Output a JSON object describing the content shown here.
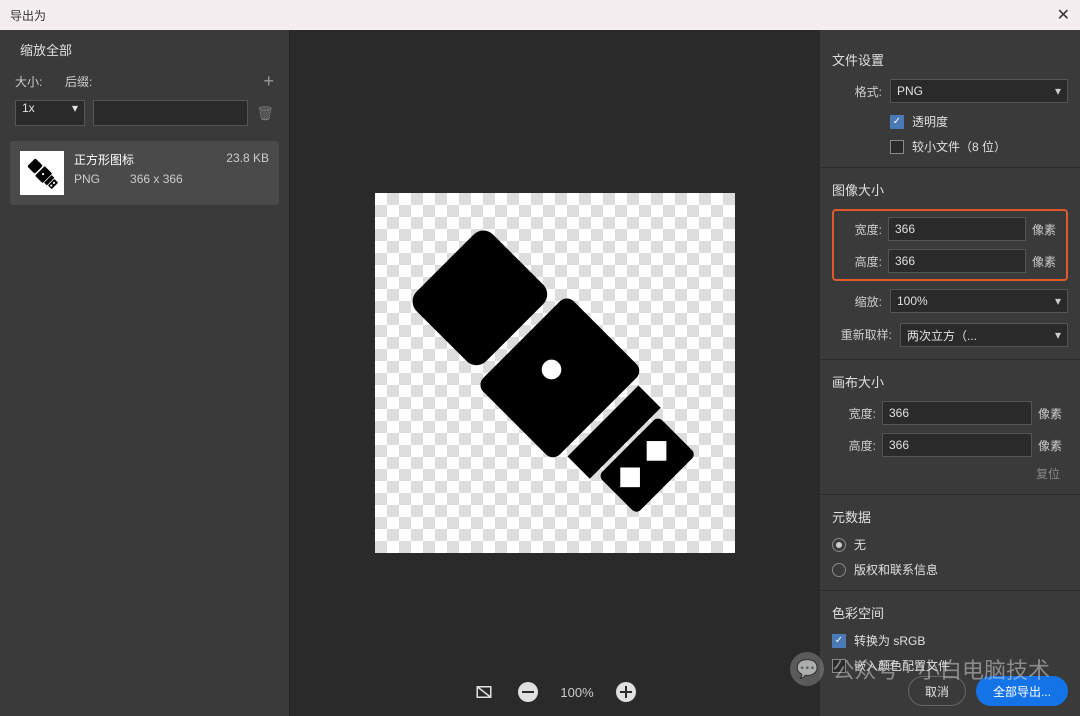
{
  "dialog": {
    "title": "导出为"
  },
  "left": {
    "scale_all": "缩放全部",
    "size_label": "大小:",
    "suffix_label": "后缀:",
    "multiplier": "1x",
    "asset": {
      "name": "正方形图标",
      "format": "PNG",
      "dimensions": "366 x 366",
      "filesize": "23.8 KB"
    }
  },
  "zoom": {
    "percent": "100%"
  },
  "right": {
    "file_settings": "文件设置",
    "format_label": "格式:",
    "format_value": "PNG",
    "transparency": "透明度",
    "smaller_file": "较小文件（8 位）",
    "image_size": "图像大小",
    "width_label": "宽度:",
    "height_label": "高度:",
    "width_value": "366",
    "height_value": "366",
    "pixel_unit": "像素",
    "scale_label": "缩放:",
    "scale_value": "100%",
    "resample_label": "重新取样:",
    "resample_value": "两次立方（...",
    "canvas_size": "画布大小",
    "canvas_width": "366",
    "canvas_height": "366",
    "reset": "复位",
    "metadata": "元数据",
    "meta_none": "无",
    "meta_copyright": "版权和联系信息",
    "color_space": "色彩空间",
    "convert_srgb": "转换为 sRGB",
    "embed_profile": "嵌入颜色配置文件"
  },
  "footer": {
    "cancel": "取消",
    "export_all": "全部导出..."
  },
  "watermark": "公众号 · 小白电脑技术"
}
